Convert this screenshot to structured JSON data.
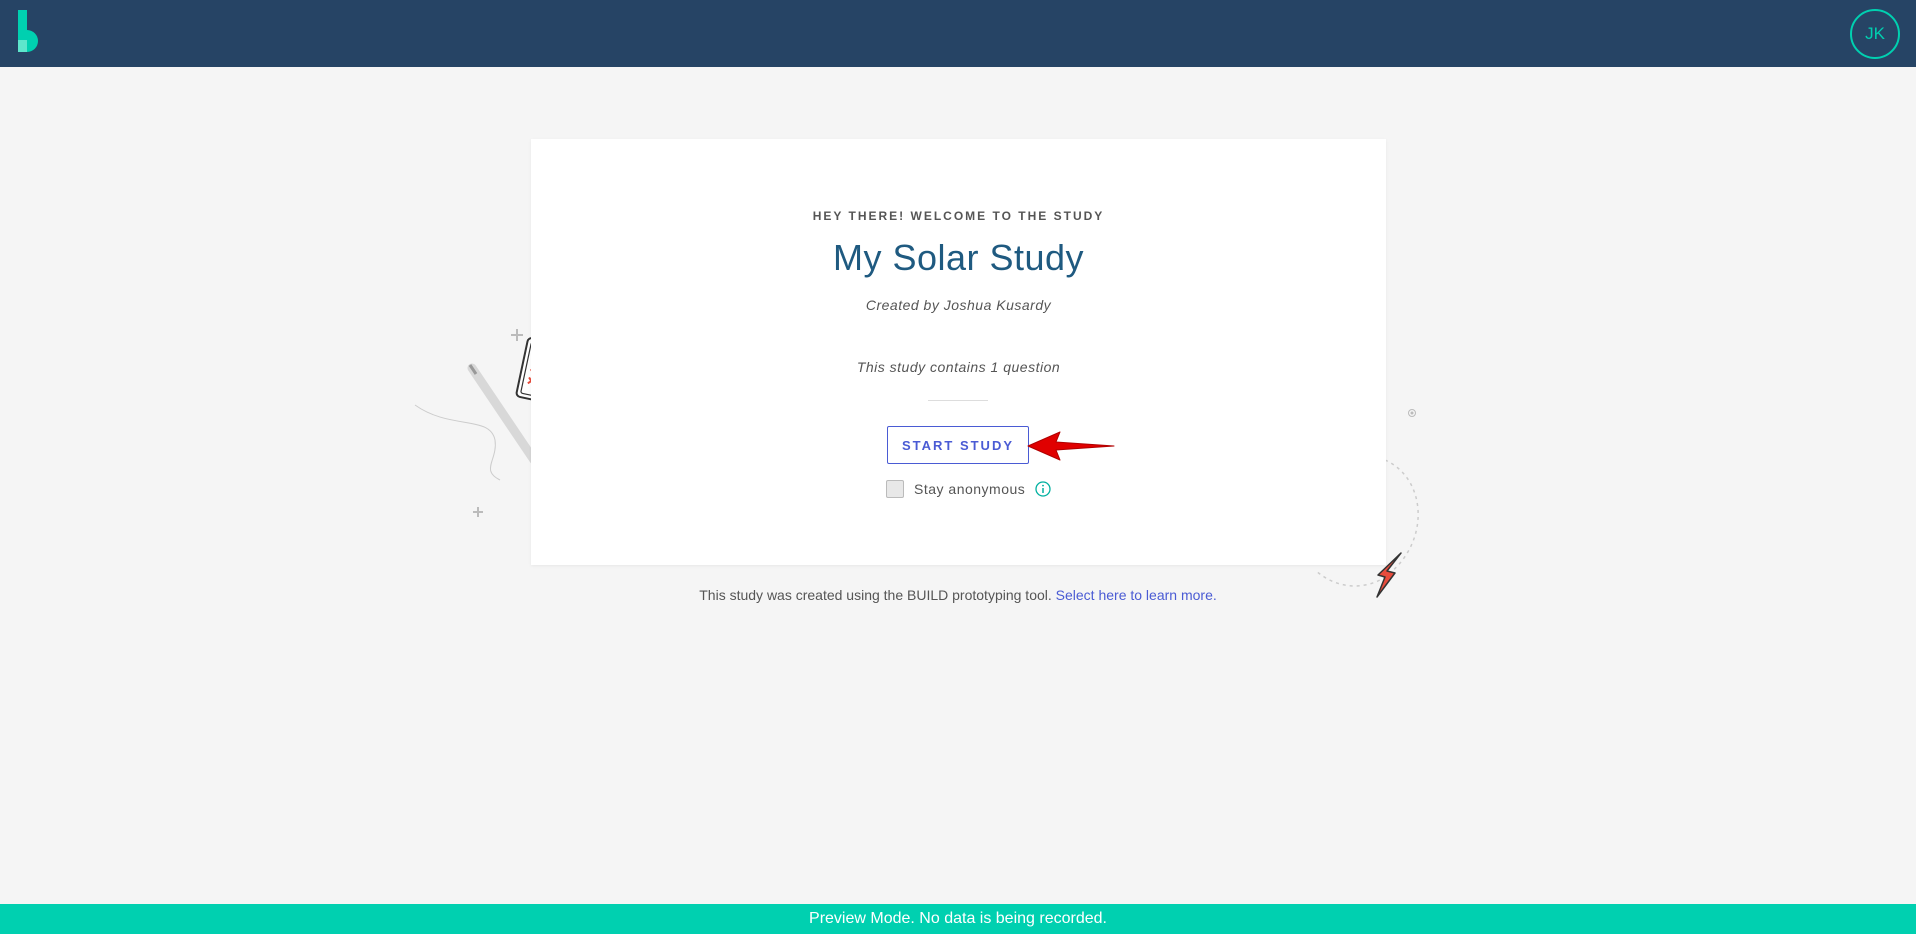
{
  "header": {
    "avatar_initials": "JK",
    "brand_color": "#264465",
    "accent_color": "#00d0b0"
  },
  "study": {
    "eyebrow": "HEY THERE! WELCOME TO THE STUDY",
    "title": "My Solar Study",
    "creator": "Created by Joshua Kusardy",
    "question_count_text": "This study contains 1 question",
    "start_button_label": "START STUDY",
    "anonymous_label": "Stay anonymous",
    "anonymous_checked": false
  },
  "footer": {
    "note_text": "This study was created using the BUILD prototyping tool.",
    "learn_more_link": "Select here to learn more."
  },
  "preview_banner": {
    "text": "Preview Mode. No data is being recorded."
  },
  "icons": [
    "build-logo-icon",
    "clipboard-icon",
    "pen-icon",
    "lightning-icon",
    "info-icon",
    "red-arrow-annotation"
  ]
}
